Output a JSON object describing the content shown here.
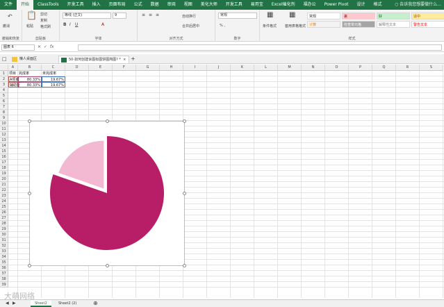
{
  "ribbon_tabs": [
    "文件",
    "开始",
    "ClassTools",
    "开发工具",
    "插入",
    "页面布局",
    "公式",
    "数据",
    "审阅",
    "视图",
    "美化大师",
    "开发工具",
    "易用宝",
    "Excel催化剂",
    "福办公",
    "Power Pivot",
    "设计",
    "格式"
  ],
  "ribbon_active_tab": "开始",
  "tell_me": "告诉我您想要做什么...",
  "clipboard": {
    "paste": "粘贴",
    "cut": "剪切",
    "copy": "复制",
    "format_painter": "格式刷",
    "label": "剪贴板",
    "recover": "撤销和恢复"
  },
  "undo_label": "撤消",
  "font": {
    "name": "等线 (正文)",
    "size": "9",
    "label": "字体"
  },
  "alignment": {
    "wrap": "自动换行",
    "merge": "合并后居中",
    "label": "对齐方式"
  },
  "number": {
    "format": "常规",
    "label": "数字"
  },
  "styles": {
    "cond_format": "条件格式",
    "table_format": "套用表格格式",
    "cells": [
      "常规",
      "差",
      "好",
      "适中",
      "计算",
      "检查单元格",
      "解释性文本",
      "警告文本"
    ],
    "label": "样式"
  },
  "name_box": "图表 6",
  "workbook_tabs": [
    {
      "label": "懒人桌面区"
    },
    {
      "label": "50-如何创建诉图标图饼图简图? *"
    }
  ],
  "columns": [
    "A",
    "B",
    "C",
    "D",
    "E",
    "F",
    "G",
    "H",
    "I",
    "J",
    "K",
    "L",
    "M",
    "N",
    "O",
    "P",
    "Q",
    "R",
    "S"
  ],
  "rows": [
    "1",
    "2",
    "3",
    "4",
    "5",
    "6",
    "7",
    "8",
    "9",
    "10",
    "11",
    "12",
    "13",
    "14",
    "15",
    "16",
    "17",
    "18",
    "19",
    "20",
    "21",
    "22",
    "23",
    "24",
    "25",
    "26",
    "27",
    "28",
    "29",
    "30",
    "31",
    "32",
    "33",
    "34",
    "35",
    "36",
    "37",
    "38",
    "39"
  ],
  "table": {
    "headers": [
      "项目",
      "完成率",
      "未完成率"
    ],
    "rows": [
      [
        "A项目",
        "80.33%",
        "19.67%"
      ],
      [
        "辅助行",
        "80.33%",
        "19.67%"
      ]
    ]
  },
  "chart_data": {
    "type": "pie",
    "categories": [
      "完成率",
      "未完成率"
    ],
    "values": [
      80.33,
      19.67
    ],
    "colors": [
      "#b81e67",
      "#f3b8d2"
    ],
    "start_angle_deg": 0
  },
  "sheet_tabs": [
    "Sheet2",
    "Sheet2 (2)"
  ],
  "active_sheet": "Sheet2",
  "watermark": "大萌网络"
}
